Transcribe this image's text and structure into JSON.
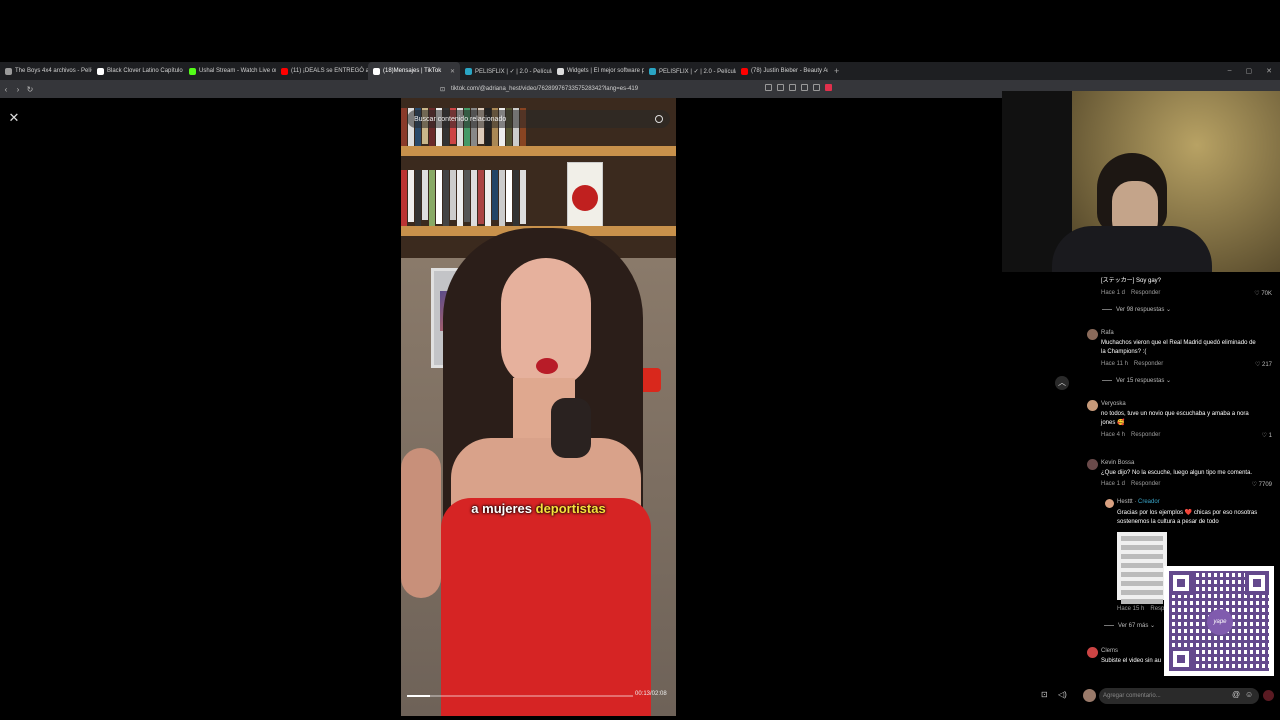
{
  "browser": {
    "tabs": [
      {
        "label": "The Boys 4x4 archivos - PelíCine HD",
        "color": "#9a9a9a",
        "active": false
      },
      {
        "label": "Black Clover Latino Capítulo 113 - Ye",
        "color": "#ffffff",
        "active": false
      },
      {
        "label": "Ushal Stream - Watch Live on Ki",
        "color": "#53fc18",
        "active": false
      },
      {
        "label": "(11) ¡DEALS se ENTREGÓ a DIO!",
        "color": "#ff0000",
        "active": false
      },
      {
        "label": "(18)Mensajes | TikTok",
        "color": "#ffffff",
        "active": true
      },
      {
        "label": "PELISFLIX | ✓ | 2.0 - Películas y Ser",
        "color": "#2aa5c4",
        "active": false
      },
      {
        "label": "Widgets | El mejor software para poc",
        "color": "#dddddd",
        "active": false
      },
      {
        "label": "PELISFLIX | ✓ | 2.0 - Películas y Serie",
        "color": "#2aa5c4",
        "active": false
      },
      {
        "label": "(78) Justin Bieber - Beauty And A Be",
        "color": "#ff0000",
        "active": false
      }
    ],
    "new_tab": "+",
    "url": "tiktok.com/@adriana_hest/video/7628997673357528342?lang=es-419"
  },
  "video": {
    "search_placeholder": "Buscar contenido relacionado",
    "caption_plain": "a mujeres ",
    "caption_highlight": "deportistas",
    "time": "00:13/02:08",
    "progress": 0.1
  },
  "comments": [
    {
      "user": "",
      "text": "[ステッカー] Soy gay?",
      "time": "Hace 1 d",
      "reply": "Responder",
      "likes": "70K",
      "replies": "Ver 98 respuestas"
    },
    {
      "user": "Rafa",
      "text": "Muchachos vieron que el Real Madrid quedó eliminado de la Champions? :(",
      "time": "Hace 11 h",
      "reply": "Responder",
      "likes": "217",
      "replies": "Ver 15 respuestas"
    },
    {
      "user": "Veryoska",
      "text": "no todos, tuve un novio que escuchaba y amaba a nora jones 🥰",
      "time": "Hace 4 h",
      "reply": "Responder",
      "likes": "1",
      "replies": ""
    },
    {
      "user": "Kevin Bossa",
      "text": "¿Que dijo? No la escuche, luego algun tipo me comenta.",
      "time": "Hace 1 d",
      "reply": "Responder",
      "likes": "7709",
      "replies": ""
    }
  ],
  "creator_reply": {
    "user": "Hesttt",
    "badge": "Creador",
    "text": "Gracias por los ejemplos ❤️ chicas por eso nosotras sostenemos la cultura a pesar de todo",
    "time": "Hace 15 h",
    "reply": "Respo",
    "more": "Ver 67 más"
  },
  "last_comment": {
    "user": "Clems",
    "text": "Subiste el video sin au"
  },
  "qr_logo": "yape",
  "comment_input": {
    "placeholder": "Agregar comentario..."
  },
  "icons": [
    "close-icon",
    "search-icon",
    "chevron-up-icon",
    "heart-icon",
    "mention-icon",
    "emoji-icon",
    "send-icon",
    "volume-icon",
    "lock-icon"
  ]
}
